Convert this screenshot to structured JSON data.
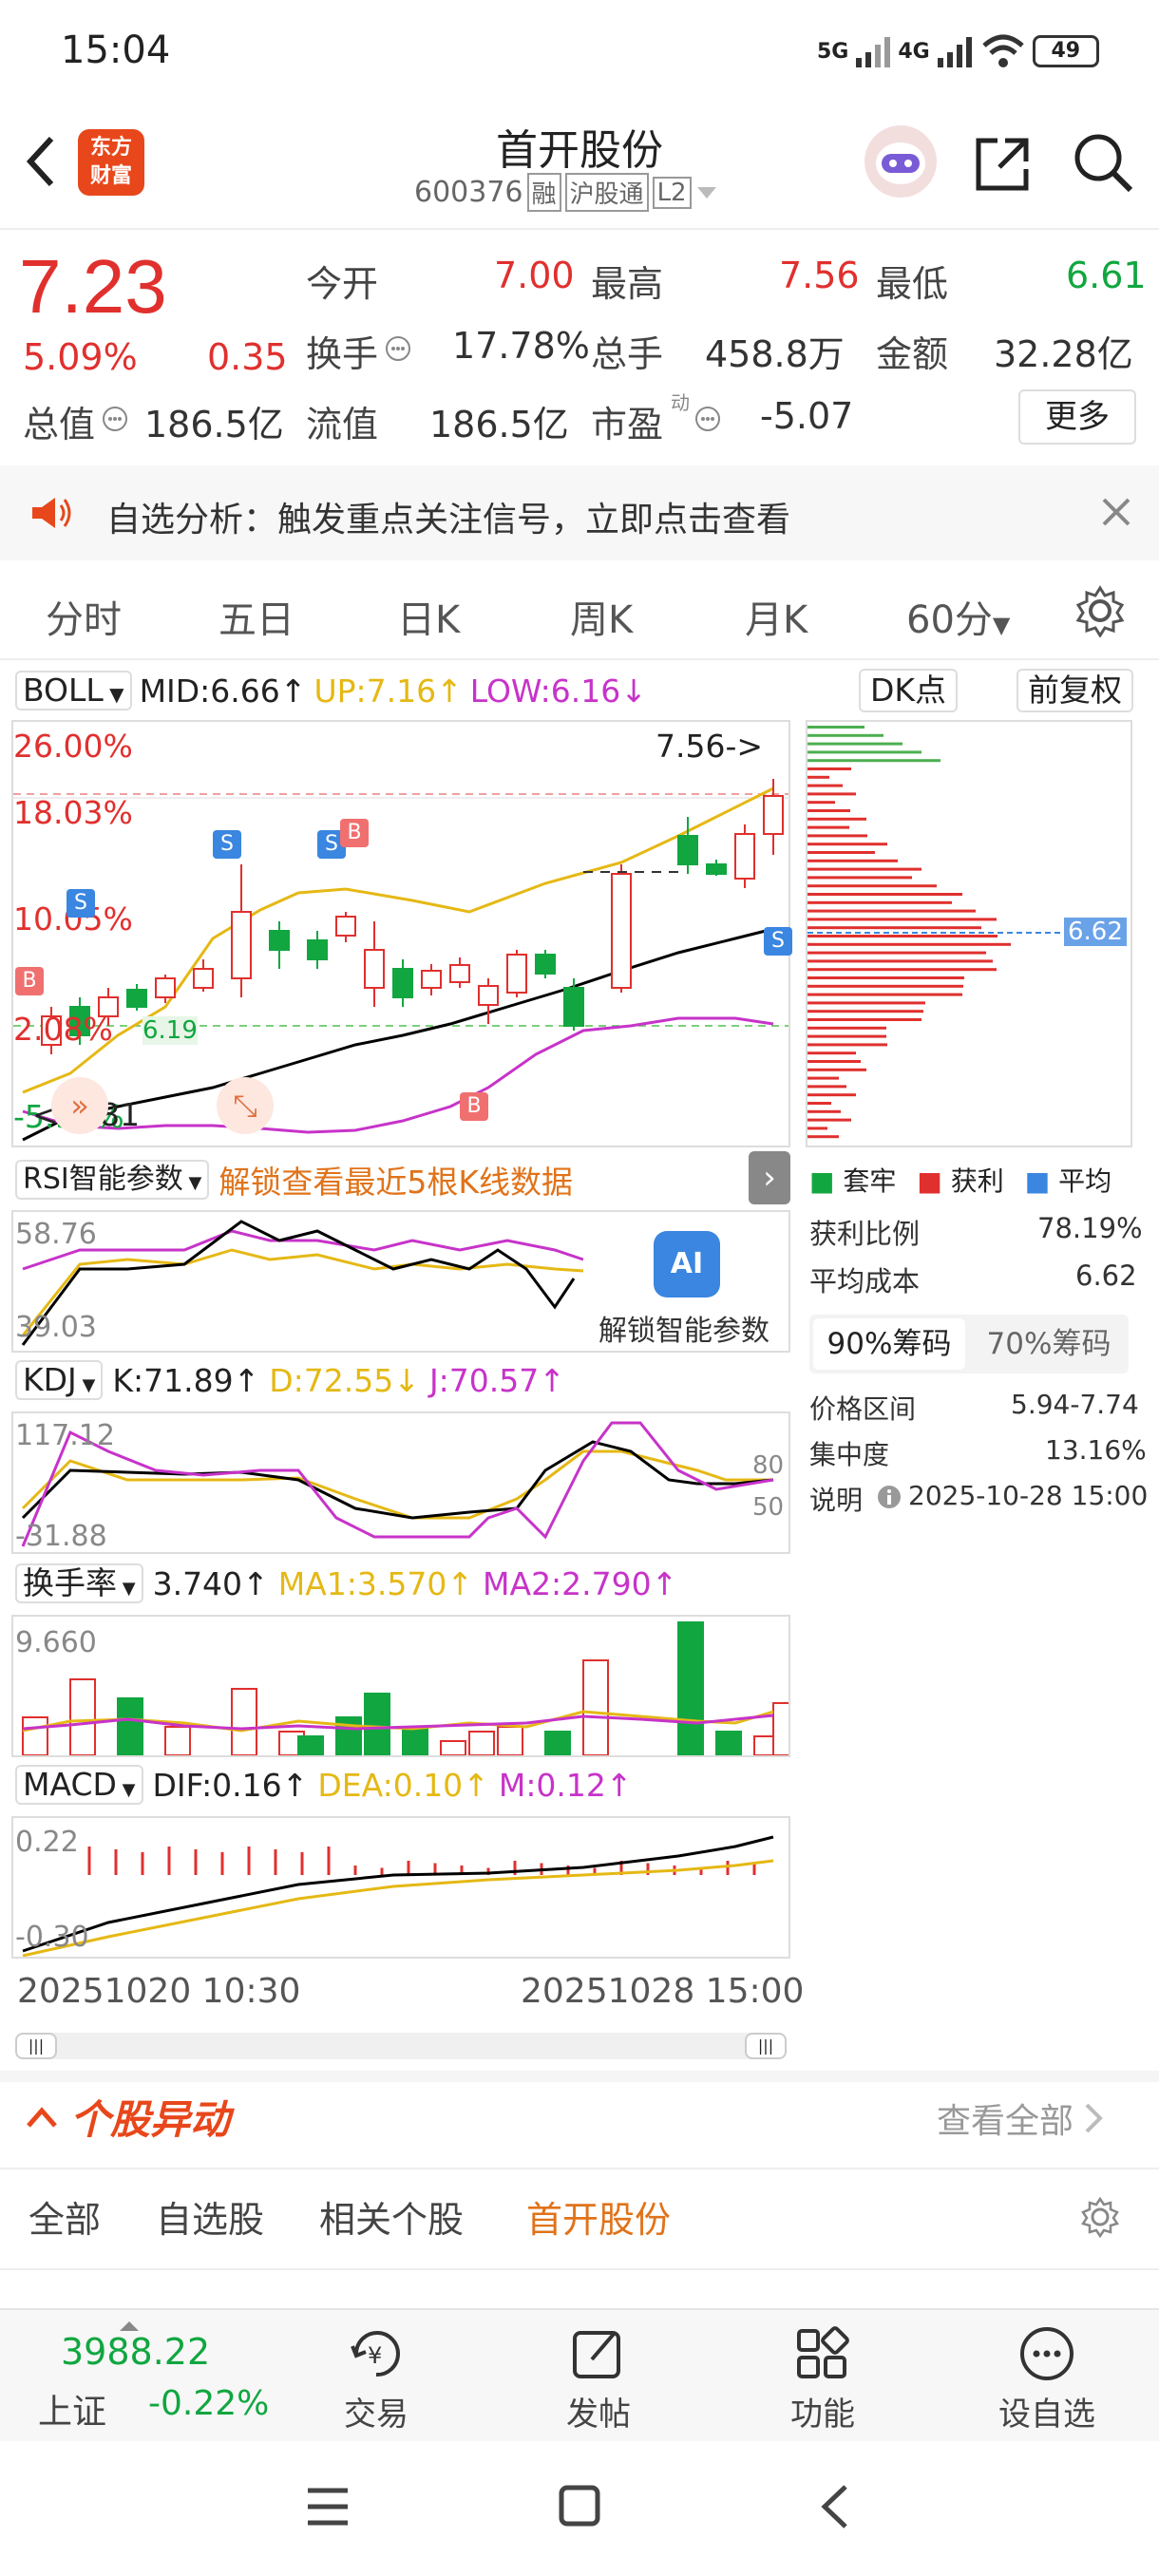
{
  "status": {
    "time": "15:04",
    "signal1": "5G",
    "signal2": "4G",
    "battery": "49"
  },
  "header": {
    "logo_line1": "东方",
    "logo_line2": "财富",
    "title": "首开股份",
    "code": "600376",
    "tag1": "融",
    "tag2": "沪股通",
    "tag3": "L2"
  },
  "quote": {
    "price": "7.23",
    "change_pct": "5.09%",
    "change": "0.35",
    "open_label": "今开",
    "open": "7.00",
    "high_label": "最高",
    "high": "7.56",
    "low_label": "最低",
    "low": "6.61",
    "turnover_label": "换手",
    "turnover": "17.78%",
    "volume_label": "总手",
    "volume": "458.8万",
    "amount_label": "金额",
    "amount": "32.28亿",
    "mcap_label": "总值",
    "mcap": "186.5亿",
    "float_label": "流值",
    "float": "186.5亿",
    "pe_label": "市盈",
    "pe_sup": "动",
    "pe": "-5.07",
    "more": "更多"
  },
  "notice": {
    "text": "自选分析：触发重点关注信号，立即点击查看"
  },
  "tabs": {
    "t1": "分时",
    "t2": "五日",
    "t3": "日K",
    "t4": "周K",
    "t5": "月K",
    "t6": "60分"
  },
  "boll": {
    "name": "BOLL",
    "mid": "MID:6.66",
    "up": "UP:7.16",
    "low": "LOW:6.16",
    "dk": "DK点",
    "adj": "前复权",
    "y1": "26.00%",
    "y2": "18.03%",
    "y3": "10.05%",
    "y4": "2.08%",
    "y5": "-5.90%",
    "max_label": "7.56->",
    "min_label": "<-5.81",
    "dashed_val": "6.19",
    "chip_price": "6.62"
  },
  "rsi": {
    "name": "RSI智能参数",
    "unlock": "解锁查看最近5根K线数据",
    "v1": "58.76",
    "v2": "39.03",
    "ai_label": "AI",
    "ai_text": "解锁智能参数"
  },
  "kdj": {
    "name": "KDJ",
    "k": "K:71.89",
    "d": "D:72.55",
    "j": "J:70.57",
    "v1": "117.12",
    "v2": "-31.88",
    "l80": "80",
    "l50": "50"
  },
  "hsl": {
    "name": "换手率",
    "v": "3.740",
    "ma1": "MA1:3.570",
    "ma2": "MA2:2.790",
    "top": "9.660"
  },
  "macd": {
    "name": "MACD",
    "dif": "DIF:0.16",
    "dea": "DEA:0.10",
    "m": "M:0.12",
    "v1": "0.22",
    "v2": "-0.30"
  },
  "dates": {
    "start": "20251020 10:30",
    "end": "20251028 15:00"
  },
  "chips": {
    "legend1": "套牢",
    "legend2": "获利",
    "legend3": "平均",
    "profit_label": "获利比例",
    "profit": "78.19%",
    "cost_label": "平均成本",
    "cost": "6.62",
    "tab90": "90%筹码",
    "tab70": "70%筹码",
    "range_label": "价格区间",
    "range": "5.94-7.74",
    "conc_label": "集中度",
    "conc": "13.16%",
    "note_label": "说明",
    "note": "2025-10-28 15:00"
  },
  "movers": {
    "title": "个股异动",
    "all": "查看全部",
    "f1": "全部",
    "f2": "自选股",
    "f3": "相关个股",
    "f4": "首开股份"
  },
  "nav": {
    "index_val": "3988.22",
    "index_name": "上证",
    "index_chg": "-0.22%",
    "trade": "交易",
    "post": "发帖",
    "func": "功能",
    "watch": "设自选"
  },
  "colors": {
    "red": "#e0302e",
    "green": "#11a640",
    "orange": "#e0731a",
    "yellow": "#e5b814",
    "magenta": "#c733c9",
    "blue": "#3a86e0"
  }
}
